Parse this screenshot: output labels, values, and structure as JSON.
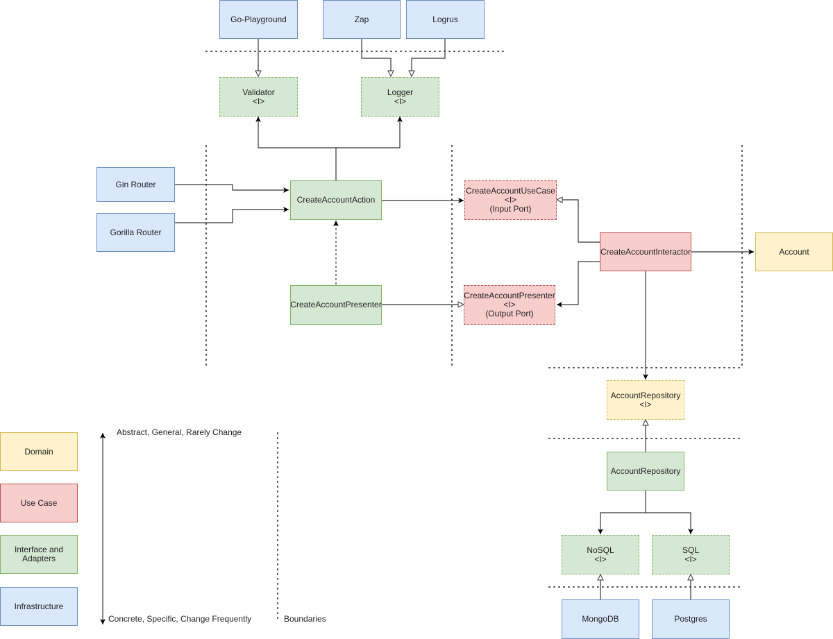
{
  "nodes": {
    "go_playground": "Go-Playground",
    "zap": "Zap",
    "logrus": "Logrus",
    "validator": "Validator\n<I>",
    "logger": "Logger\n<I>",
    "gin_router": "Gin Router",
    "gorilla_router": "Gorilla Router",
    "create_account_action": "CreateAccountAction",
    "create_account_presenter": "CreateAccountPresenter",
    "create_account_usecase": "CreateAccountUseCase\n<I>\n(Input Port)",
    "create_account_presenter_port": "CreateAccountPresenter\n<I>\n(Output Port)",
    "create_account_interactor": "CreateAccountInteractor",
    "account": "Account",
    "account_repository_iface": "AccountRepository\n<I>",
    "account_repository": "AccountRepository",
    "nosql": "NoSQL\n<I>",
    "sql": "SQL\n<I>",
    "mongodb": "MongoDB",
    "postgres": "Postgres"
  },
  "legend": {
    "domain": "Domain",
    "use_case": "Use Case",
    "interface_adapters": "Interface and\nAdapters",
    "infrastructure": "Infrastructure",
    "top_label": "Abstract, General, Rarely Change",
    "bottom_label": "Concrete, Specific, Change Frequently",
    "boundaries_label": "Boundaries"
  },
  "colors": {
    "domain": "#fff2cc",
    "use_case": "#f8cecc",
    "interface_adapters": "#d5e8d4",
    "infrastructure": "#dae8fc"
  }
}
